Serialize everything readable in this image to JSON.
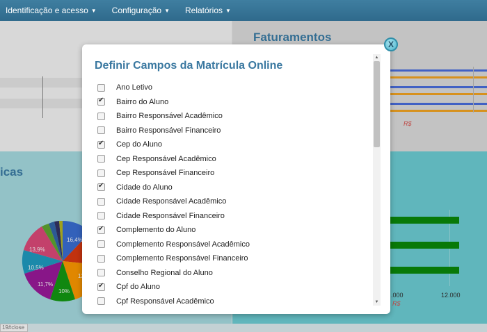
{
  "navbar": {
    "items": [
      {
        "label": "Identificação e acesso"
      },
      {
        "label": "Configuração"
      },
      {
        "label": "Relatórios"
      }
    ]
  },
  "background": {
    "faturamentos_title": "Faturamentos",
    "currency_label": "R$",
    "left_section_title": "icas",
    "pie_labels": [
      "16,4%",
      "13,9%",
      "10,5%",
      "11,7%",
      "10%",
      "12,"
    ],
    "axis_ticks": [
      ".000",
      "12.000"
    ],
    "footer_link": "19#close"
  },
  "modal": {
    "title": "Definir Campos da Matrícula Online",
    "close_label": "X",
    "fields": [
      {
        "label": "Ano Letivo",
        "checked": false
      },
      {
        "label": "Bairro do Aluno",
        "checked": true
      },
      {
        "label": "Bairro Responsável Acadêmico",
        "checked": false
      },
      {
        "label": "Bairro Responsável Financeiro",
        "checked": false
      },
      {
        "label": "Cep do Aluno",
        "checked": true
      },
      {
        "label": "Cep Responsável Acadêmico",
        "checked": false
      },
      {
        "label": "Cep Responsável Financeiro",
        "checked": false
      },
      {
        "label": "Cidade do Aluno",
        "checked": true
      },
      {
        "label": "Cidade Responsável Acadêmico",
        "checked": false
      },
      {
        "label": "Cidade Responsável Financeiro",
        "checked": false
      },
      {
        "label": "Complemento do Aluno",
        "checked": true
      },
      {
        "label": "Complemento Responsável Acadêmico",
        "checked": false
      },
      {
        "label": "Complemento Responsável Financeiro",
        "checked": false
      },
      {
        "label": "Conselho Regional do Aluno",
        "checked": false
      },
      {
        "label": "Cpf do Aluno",
        "checked": true
      },
      {
        "label": "Cpf Responsável Acadêmico",
        "checked": false
      }
    ]
  },
  "colors": {
    "navbar": "#3a7799",
    "title": "#3a78a0",
    "pie": [
      "#3b6fd4",
      "#de4a7a",
      "#1f9dc2",
      "#9b1a9b",
      "#139a13",
      "#ff9a00",
      "#dc3912"
    ]
  }
}
